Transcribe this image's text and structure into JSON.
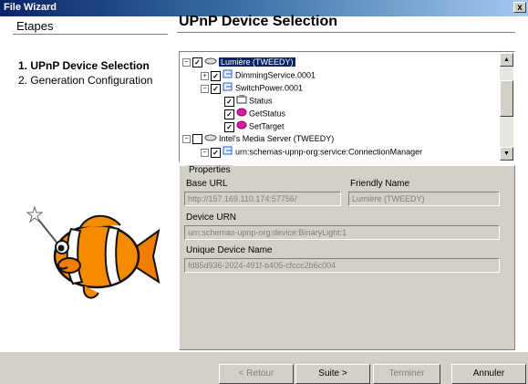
{
  "window": {
    "title": "File Wizard",
    "close_glyph": "x"
  },
  "steps": {
    "header": "Etapes",
    "items": [
      {
        "label": "1. UPnP Device Selection",
        "active": true
      },
      {
        "label": "2. Generation Configuration",
        "active": false
      }
    ]
  },
  "page": {
    "title": "UPnP Device Selection"
  },
  "tree": {
    "nodes": [
      {
        "label": "Lumière (TWEEDY)",
        "expander": "−",
        "checked": true,
        "icon": "device-icon",
        "selected": true
      },
      {
        "label": "DimmingService.0001",
        "expander": "+",
        "checked": true,
        "icon": "service-icon",
        "selected": false
      },
      {
        "label": "SwitchPower.0001",
        "expander": "−",
        "checked": true,
        "icon": "service-icon",
        "selected": false
      },
      {
        "label": "Status",
        "expander": "",
        "checked": true,
        "icon": "state-variable-icon",
        "selected": false
      },
      {
        "label": "GetStatus",
        "expander": "",
        "checked": true,
        "icon": "action-icon",
        "selected": false
      },
      {
        "label": "SetTarget",
        "expander": "",
        "checked": true,
        "icon": "action-icon",
        "selected": false
      },
      {
        "label": "Intel's Media Server (TWEEDY)",
        "expander": "−",
        "checked": false,
        "icon": "device-icon",
        "selected": false
      },
      {
        "label": "urn:schemas-upnp-org:service:ConnectionManager",
        "expander": "−",
        "checked": true,
        "icon": "service-icon",
        "selected": false
      }
    ]
  },
  "properties": {
    "legend": "Properties",
    "base_url_label": "Base URL",
    "base_url_value": "http://157.169.110.174:57756/",
    "friendly_name_label": "Friendly Name",
    "friendly_name_value": "Lumière (TWEEDY)",
    "device_urn_label": "Device URN",
    "device_urn_value": "urn:schemas-upnp-org:device:BinaryLight:1",
    "udn_label": "Unique Device Name",
    "udn_value": "fd85d936-2024-491f-b405-cfccc2b6c004"
  },
  "buttons": {
    "back": "< Retour",
    "next": "Suite >",
    "finish": "Terminer",
    "cancel": "Annuler"
  },
  "colors": {
    "selection": "#0a246a",
    "title_gradient_start": "#0a246a",
    "title_gradient_end": "#a6caf0"
  }
}
